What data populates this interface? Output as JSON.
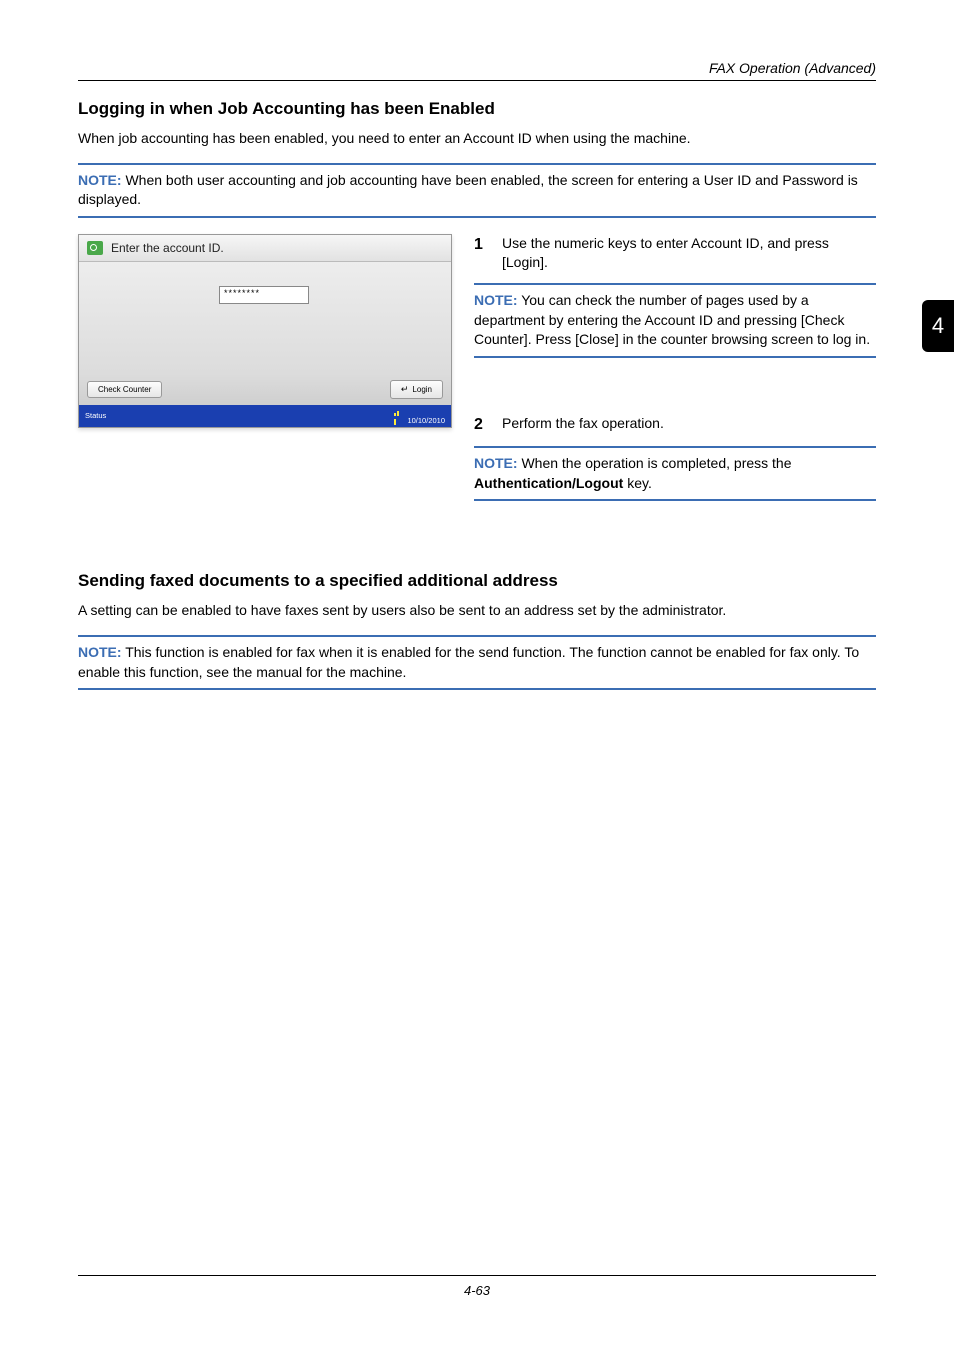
{
  "runningHead": "FAX Operation (Advanced)",
  "tabNumber": "4",
  "section1": {
    "heading": "Logging in when Job Accounting has been Enabled",
    "intro": "When job accounting has been enabled, you need to enter an Account ID when using the machine.",
    "note1": {
      "label": "NOTE:",
      "text": " When both user accounting and job accounting have been enabled, the screen for entering a User ID and Password is displayed."
    },
    "step1": {
      "num": "1",
      "text": "Use the numeric keys to enter Account ID, and press [Login]."
    },
    "note2": {
      "label": "NOTE:",
      "text": " You can check the number of pages used by a department by entering the Account ID and pressing [Check Counter]. Press [Close] in the counter browsing screen to log in."
    },
    "step2": {
      "num": "2",
      "text": "Perform the fax operation."
    },
    "note3": {
      "label": "NOTE:",
      "text_a": " When the operation is completed, press the ",
      "bold": "Authentication/Logout",
      "text_b": " key."
    }
  },
  "screenshot": {
    "title": "Enter the account ID.",
    "fieldValue": "********",
    "checkCounter": "Check Counter",
    "login": "Login",
    "statusLabel": "Status",
    "statusDate": "10/10/2010"
  },
  "section2": {
    "heading": "Sending faxed documents to a specified additional address",
    "intro": "A setting can be enabled to have faxes sent by users also be sent to an address set by the administrator.",
    "note": {
      "label": "NOTE:",
      "text": " This function is enabled for fax when it is enabled for the send function. The function cannot be enabled for fax only. To enable this function, see the manual for the machine."
    }
  },
  "pageNumber": "4-63"
}
